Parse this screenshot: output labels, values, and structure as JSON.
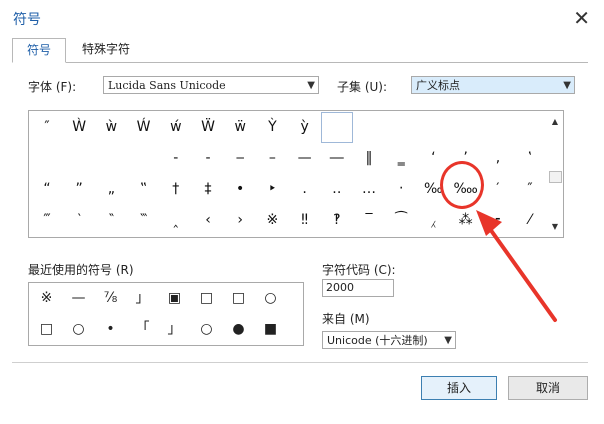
{
  "dialog": {
    "title": "符号",
    "close_glyph": "✕"
  },
  "tabs": [
    {
      "label": "符号",
      "active": true
    },
    {
      "label": "特殊字符",
      "active": false
    }
  ],
  "font": {
    "label": "字体 (F):",
    "value": "Lucida Sans Unicode"
  },
  "subset": {
    "label": "子集 (U):",
    "value": "广义标点"
  },
  "symbol_grid": {
    "rows": [
      [
        "″",
        "Ẁ",
        "ẁ",
        "Ẃ",
        "ẃ",
        "Ẅ",
        "ẅ",
        "Ỳ",
        "ỳ",
        "",
        "",
        "",
        "",
        "",
        "",
        ""
      ],
      [
        "",
        "",
        "",
        "",
        "‐",
        "‑",
        "‒",
        "–",
        "—",
        "―",
        "‖",
        "‗",
        "‘",
        "’",
        "‚",
        "‛"
      ],
      [
        "“",
        "”",
        "„",
        "‟",
        "†",
        "‡",
        "•",
        "‣",
        "․",
        "‥",
        "…",
        "‧",
        "‰",
        "‱",
        "′",
        "″"
      ],
      [
        "‴",
        "‵",
        "‶",
        "‷",
        "‸",
        "‹",
        "›",
        "※",
        "‼",
        "‽",
        "‾",
        "⁀",
        "⁁",
        "⁂",
        "⁃",
        "⁄"
      ]
    ],
    "selected_index": 9
  },
  "recent": {
    "label": "最近使用的符号 (R)",
    "symbols": [
      "※",
      "—",
      "⅞",
      "」",
      "▣",
      "□",
      "□",
      "○",
      "□",
      "○",
      "•",
      "「",
      "」",
      "○",
      "●",
      "■"
    ]
  },
  "char_code": {
    "label": "字符代码 (C):",
    "value": "2000"
  },
  "from": {
    "label": "来自 (M)",
    "value": "Unicode (十六进制)"
  },
  "buttons": {
    "insert": "插入",
    "cancel": "取消"
  },
  "colors": {
    "annotation": "#e8352a",
    "title": "#1f5fa8"
  }
}
